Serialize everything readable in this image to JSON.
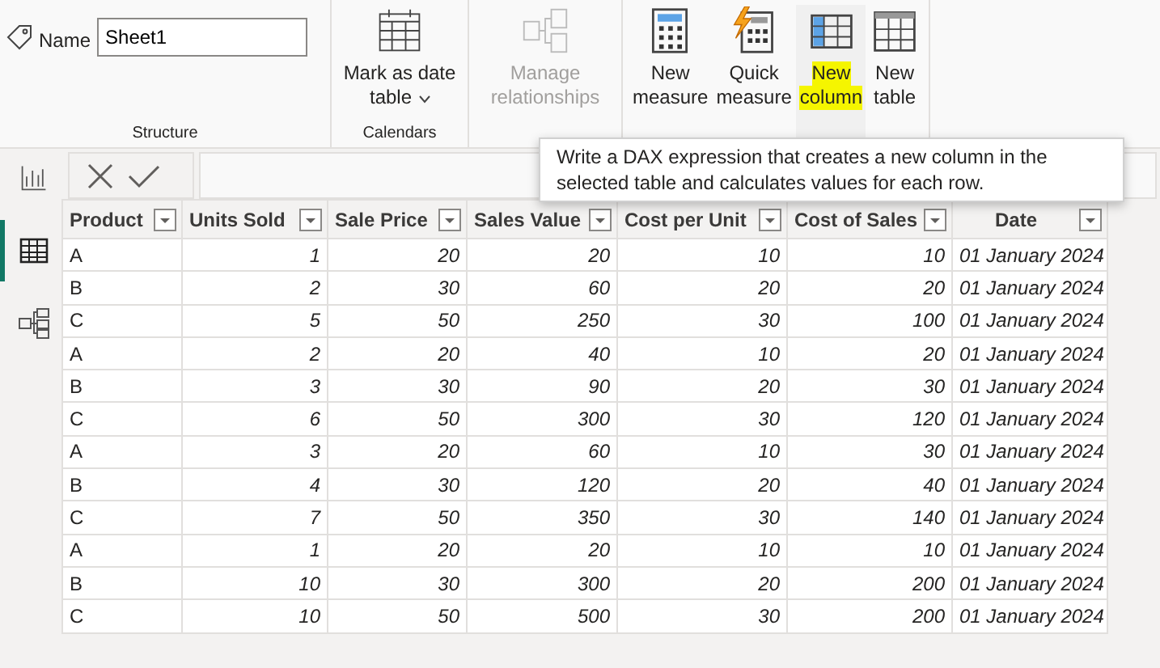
{
  "ribbon": {
    "name_label": "Name",
    "name_value": "Sheet1",
    "groups": [
      {
        "label": "Structure",
        "kind": "name"
      },
      {
        "label": "Calendars",
        "kind": "buttons",
        "buttons": [
          {
            "label": "Mark as date",
            "label2": "table",
            "disabled": false,
            "dropdown": true,
            "highlighted": false
          }
        ]
      },
      {
        "kind": "buttons",
        "buttons": [
          {
            "label": "Manage",
            "label2": "relationships",
            "disabled": true,
            "dropdown": false,
            "highlighted": false
          }
        ]
      },
      {
        "kind": "buttons",
        "buttons": [
          {
            "label": "New",
            "label2": "measure",
            "disabled": false,
            "dropdown": false,
            "highlighted": false
          },
          {
            "label": "Quick",
            "label2": "measure",
            "disabled": false,
            "dropdown": false,
            "highlighted": false
          },
          {
            "label": "New",
            "label2": "column",
            "disabled": false,
            "dropdown": false,
            "highlighted": true
          },
          {
            "label": "New",
            "label2": "table",
            "disabled": false,
            "dropdown": false,
            "highlighted": false
          }
        ]
      }
    ]
  },
  "tooltip": "Write a DAX expression that creates a new column in the selected table and calculates values for each row.",
  "rail": [
    {
      "selected": false
    },
    {
      "selected": true
    },
    {
      "selected": false
    }
  ],
  "table": {
    "columns": [
      "Product",
      "Units Sold",
      "Sale Price",
      "Sales Value",
      "Cost per Unit",
      "Cost of Sales",
      "Date"
    ],
    "rows": [
      [
        "A",
        "1",
        "20",
        "20",
        "10",
        "10",
        "01 January 2024"
      ],
      [
        "B",
        "2",
        "30",
        "60",
        "20",
        "20",
        "01 January 2024"
      ],
      [
        "C",
        "5",
        "50",
        "250",
        "30",
        "100",
        "01 January 2024"
      ],
      [
        "A",
        "2",
        "20",
        "40",
        "10",
        "20",
        "01 January 2024"
      ],
      [
        "B",
        "3",
        "30",
        "90",
        "20",
        "30",
        "01 January 2024"
      ],
      [
        "C",
        "6",
        "50",
        "300",
        "30",
        "120",
        "01 January 2024"
      ],
      [
        "A",
        "3",
        "20",
        "60",
        "10",
        "30",
        "01 January 2024"
      ],
      [
        "B",
        "4",
        "30",
        "120",
        "20",
        "40",
        "01 January 2024"
      ],
      [
        "C",
        "7",
        "50",
        "350",
        "30",
        "140",
        "01 January 2024"
      ],
      [
        "A",
        "1",
        "20",
        "20",
        "10",
        "10",
        "01 January 2024"
      ],
      [
        "B",
        "10",
        "30",
        "300",
        "20",
        "200",
        "01 January 2024"
      ],
      [
        "C",
        "10",
        "50",
        "500",
        "30",
        "200",
        "01 January 2024"
      ]
    ]
  }
}
